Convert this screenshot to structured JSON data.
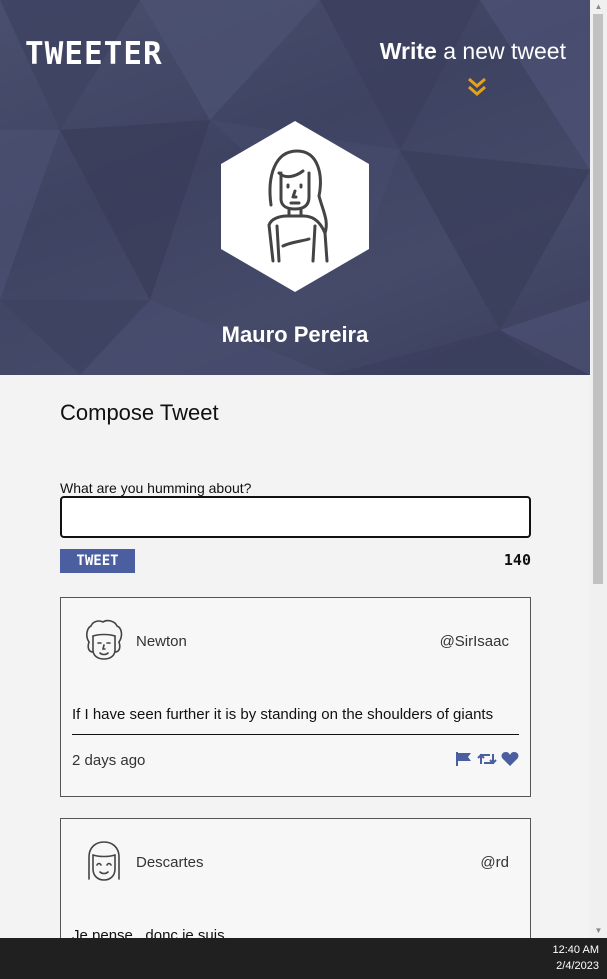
{
  "header": {
    "logo": "TWEETER",
    "write_bold": "Write",
    "write_rest": " a new tweet",
    "username": "Mauro Pereira"
  },
  "compose": {
    "title": "Compose Tweet",
    "prompt": "What are you humming about?",
    "input_value": "",
    "button_label": "TWEET",
    "counter": "140"
  },
  "tweets": [
    {
      "name": "Newton",
      "handle": "@SirIsaac",
      "text": "If I have seen further it is by standing on the shoulders of giants",
      "time": "2 days ago"
    },
    {
      "name": "Descartes",
      "handle": "@rd",
      "text": "Je pense , donc je suis",
      "time": ""
    }
  ],
  "taskbar": {
    "time": "12:40 AM",
    "date": "2/4/2023"
  },
  "colors": {
    "header_bg": "#43486a",
    "accent": "#4a5ea0",
    "chevron": "#e3a21a"
  }
}
